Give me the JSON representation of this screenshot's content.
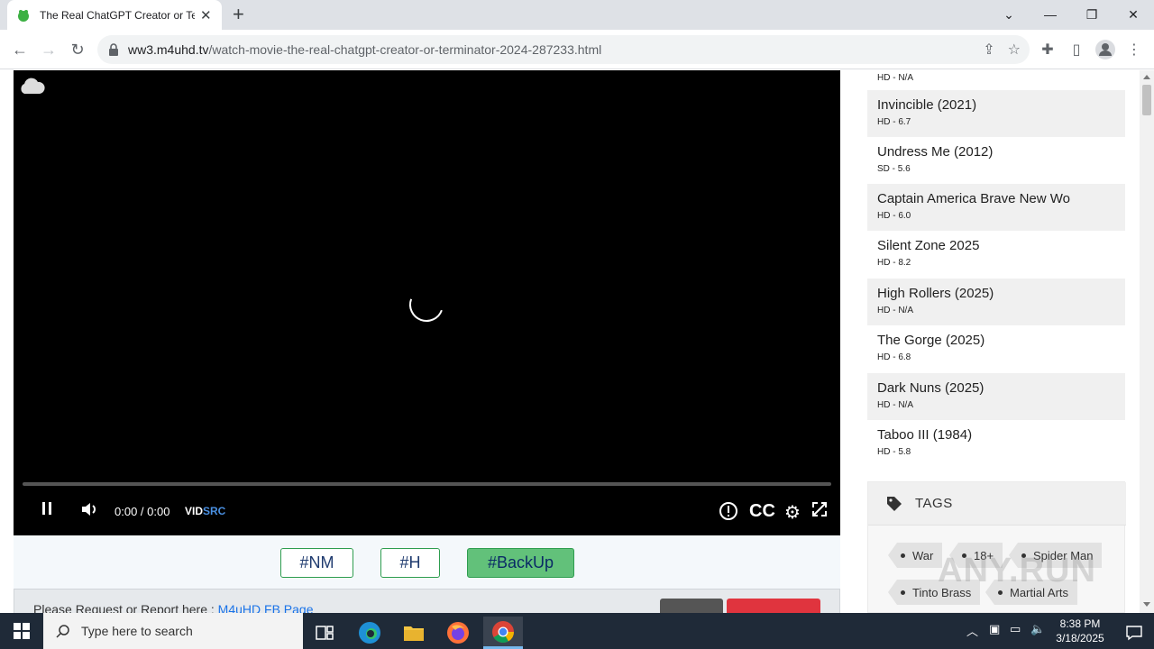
{
  "browser": {
    "tab_title": "The Real ChatGPT Creator or Terminator",
    "url_host": "ww3.m4uhd.tv",
    "url_path": "/watch-movie-the-real-chatgpt-creator-or-terminator-2024-287233.html"
  },
  "player": {
    "timecode": "0:00 / 0:00",
    "brand_vid": "VID",
    "brand_src": "SRC",
    "progress": 0,
    "state": "loading"
  },
  "servers": {
    "chips": [
      "#NM",
      "#H",
      "#BackUp"
    ],
    "active": "#BackUp"
  },
  "request": {
    "text": "Please Request or Report here : ",
    "link": "M4uHD FB Page"
  },
  "sidebar": {
    "top_meta": "HD - N/A",
    "movies": [
      {
        "title": "Invincible (2021)",
        "meta": "HD - 6.7"
      },
      {
        "title": "Undress Me (2012)",
        "meta": "SD - 5.6"
      },
      {
        "title": "Captain America Brave New Wo",
        "meta": "HD - 6.0"
      },
      {
        "title": "Silent Zone 2025",
        "meta": "HD - 8.2"
      },
      {
        "title": "High Rollers (2025)",
        "meta": "HD - N/A"
      },
      {
        "title": "The Gorge (2025)",
        "meta": "HD - 6.8"
      },
      {
        "title": "Dark Nuns (2025)",
        "meta": "HD - N/A"
      },
      {
        "title": "Taboo III (1984)",
        "meta": "HD - 5.8"
      }
    ],
    "tags_title": "TAGS",
    "tags": [
      "War",
      "18+",
      "Spider Man",
      "Tinto Brass",
      "Martial Arts"
    ]
  },
  "taskbar": {
    "search_placeholder": "Type here to search",
    "time": "8:38 PM",
    "date": "3/18/2025"
  },
  "watermark": "ANY.RUN",
  "colors": {
    "chip_border": "#2e9d4f",
    "chip_active": "#62c17a",
    "link": "#1a73e8",
    "brand_src": "#4a90e2"
  }
}
